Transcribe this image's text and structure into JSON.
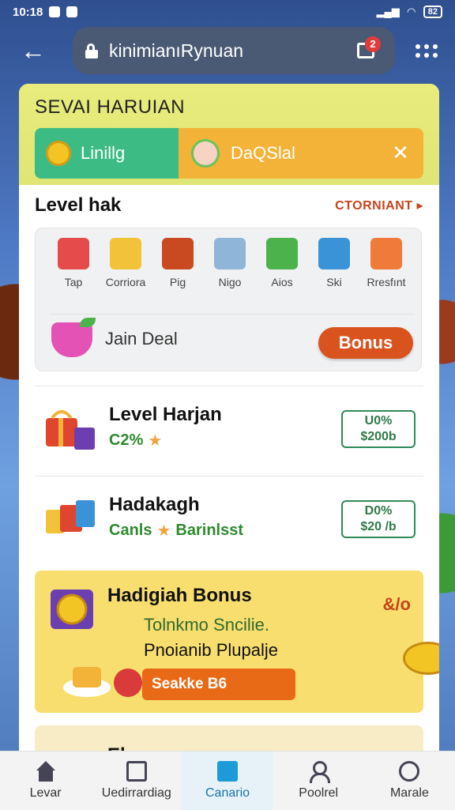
{
  "status_bar": {
    "time": "10:18",
    "battery": "82"
  },
  "browser": {
    "url_text": "kinimianıRynuan",
    "notification_count": "2"
  },
  "header": {
    "title": "SEVAI HARUIAN",
    "tab_left": "Linillg",
    "tab_right": "DaQSlal"
  },
  "section": {
    "title": "Level hak",
    "link": "CTORNIANT ▸"
  },
  "icons": [
    {
      "label": "Tap",
      "icon": "cup-icon",
      "color": "#e64b4b"
    },
    {
      "label": "Corriora",
      "icon": "ticket-icon",
      "color": "#f2c33a"
    },
    {
      "label": "Pig",
      "icon": "pot-icon",
      "color": "#c94a20"
    },
    {
      "label": "Nigo",
      "icon": "jar-icon",
      "color": "#8fb5d8"
    },
    {
      "label": "Aios",
      "icon": "blocks-icon",
      "color": "#4cb34c"
    },
    {
      "label": "Ski",
      "icon": "globe-icon",
      "color": "#3a93d6"
    },
    {
      "label": "Rresfınt",
      "icon": "gift-cubes-icon",
      "color": "#f07a3a"
    }
  ],
  "deal": {
    "label": "Jain Deal",
    "button": "Bonus"
  },
  "rewards": [
    {
      "title": "Level Harjan",
      "sub": "C2%",
      "sub2": "",
      "pill_top": "U0%",
      "pill_bottom": "$200b"
    },
    {
      "title": "Hadakagh",
      "sub": "Canls",
      "sub2": "Barinlsst",
      "pill_top": "D0%",
      "pill_bottom": "$20 /b"
    }
  ],
  "bonus": {
    "title": "Hadigiah Bonus",
    "percent": "&/o",
    "line1": "Tolnkmo Sncilie.",
    "line2": "Pnoianib Plupalje",
    "code": "Seakke B6"
  },
  "next_title": "Eho",
  "nav": [
    {
      "label": "Levar",
      "icon": "home-icon"
    },
    {
      "label": "Uedirrardiag",
      "icon": "document-icon"
    },
    {
      "label": "Canario",
      "icon": "card-icon"
    },
    {
      "label": "Poolrel",
      "icon": "user-icon"
    },
    {
      "label": "Marale",
      "icon": "clock-icon"
    }
  ]
}
